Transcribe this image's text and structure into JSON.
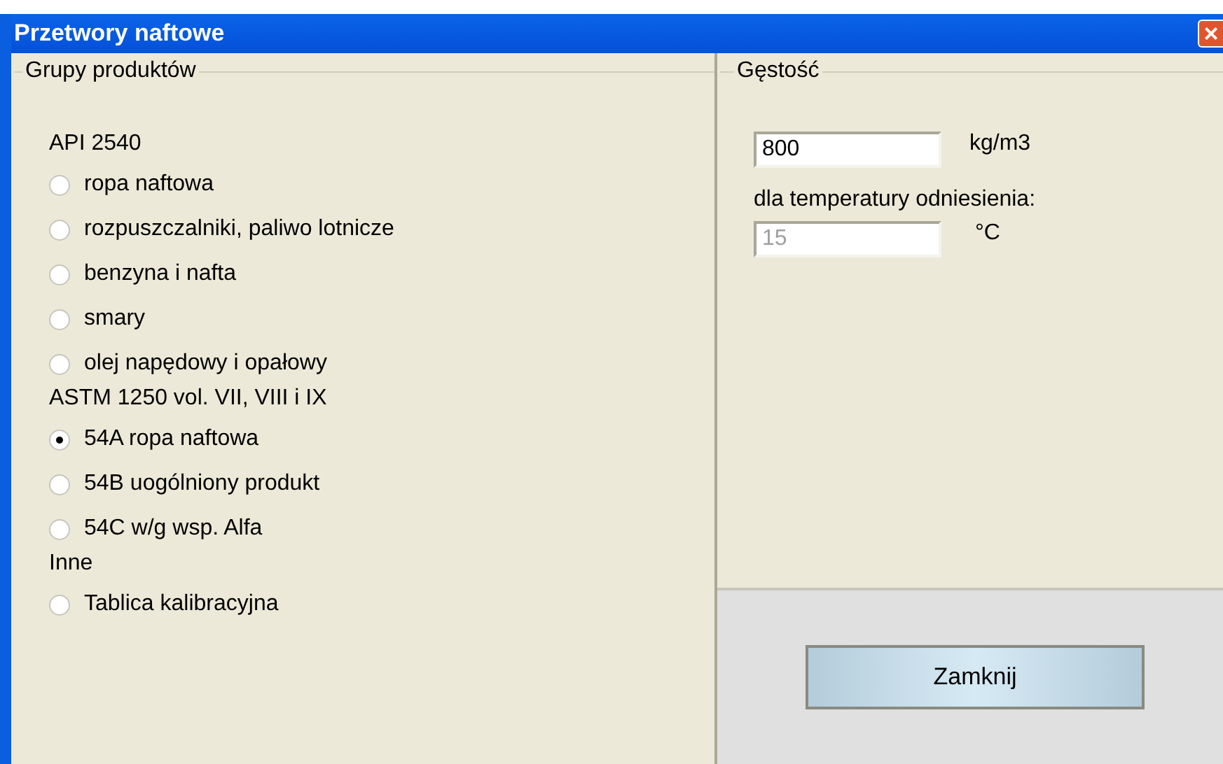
{
  "window": {
    "title": "Przetwory naftowe",
    "close": "×"
  },
  "product_groups": {
    "title": "Grupy produktów",
    "sections": [
      {
        "heading": "API 2540",
        "options": [
          {
            "label": "ropa naftowa",
            "selected": false
          },
          {
            "label": "rozpuszczalniki, paliwo lotnicze",
            "selected": false
          },
          {
            "label": "benzyna i nafta",
            "selected": false
          },
          {
            "label": "smary",
            "selected": false
          },
          {
            "label": "olej napędowy i opałowy",
            "selected": false
          }
        ]
      },
      {
        "heading": "ASTM 1250 vol. VII, VIII i IX",
        "options": [
          {
            "label": "54A ropa naftowa",
            "selected": true
          },
          {
            "label": "54B uogólniony produkt",
            "selected": false
          },
          {
            "label": "54C w/g wsp. Alfa",
            "selected": false
          }
        ]
      },
      {
        "heading": "Inne",
        "options": [
          {
            "label": "Tablica kalibracyjna",
            "selected": false
          }
        ]
      }
    ]
  },
  "density": {
    "title": "Gęstość",
    "value": "800",
    "unit": "kg/m3",
    "reference_label": "dla temperatury odniesienia:",
    "temperature": {
      "value": "15",
      "unit": "°C",
      "disabled": true
    }
  },
  "close_button": {
    "label": "Zamknij"
  }
}
